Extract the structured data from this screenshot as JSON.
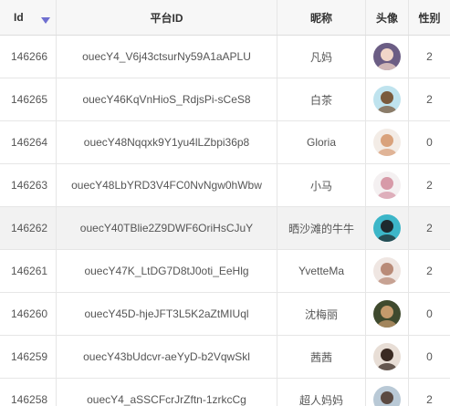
{
  "table": {
    "columns": {
      "id": "Id",
      "platform_id": "平台ID",
      "nickname": "昵称",
      "avatar": "头像",
      "gender": "性别"
    },
    "rows": [
      {
        "id": "146266",
        "platform_id": "ouecY4_V6j43ctsurNy59A1aAPLU",
        "nickname": "凡妈",
        "gender": "2",
        "avatar_icon": "avatar-woman-icon",
        "avatar_bg": "#6b5d84",
        "avatar_fg": "#f1d6c8"
      },
      {
        "id": "146265",
        "platform_id": "ouecY46KqVnHioS_RdjsPi-sCeS8",
        "nickname": "白茶",
        "gender": "2",
        "avatar_icon": "avatar-cartoon-girl-icon",
        "avatar_bg": "#bfe3ee",
        "avatar_fg": "#7a5a3c"
      },
      {
        "id": "146264",
        "platform_id": "ouecY48Nqqxk9Y1yu4lLZbpi36p8",
        "nickname": "Gloria",
        "gender": "0",
        "avatar_icon": "avatar-baby-icon",
        "avatar_bg": "#f3ece6",
        "avatar_fg": "#d9a27c"
      },
      {
        "id": "146263",
        "platform_id": "ouecY48LbYRD3V4FC0NvNgw0hWbw",
        "nickname": "小马",
        "gender": "2",
        "avatar_icon": "avatar-small-figure-icon",
        "avatar_bg": "#f4f0f1",
        "avatar_fg": "#d79aa8"
      },
      {
        "id": "146262",
        "platform_id": "ouecY40TBlie2Z9DWF6OriHsCJuY",
        "nickname": "晒沙滩的牛牛",
        "gender": "2",
        "avatar_icon": "avatar-beach-icon",
        "avatar_bg": "#3cb6c8",
        "avatar_fg": "#1e2a2e"
      },
      {
        "id": "146261",
        "platform_id": "ouecY47K_LtDG7D8tJ0oti_EeHlg",
        "nickname": "YvetteMa",
        "gender": "2",
        "avatar_icon": "avatar-woman-sketch-icon",
        "avatar_bg": "#efe6e2",
        "avatar_fg": "#b98b78"
      },
      {
        "id": "146260",
        "platform_id": "ouecY45D-hjeJFT3L5K2aZtMIUql",
        "nickname": "沈梅丽",
        "gender": "0",
        "avatar_icon": "avatar-outdoor-icon",
        "avatar_bg": "#3f4a2e",
        "avatar_fg": "#c49a6c"
      },
      {
        "id": "146259",
        "platform_id": "ouecY43bUdcvr-aeYyD-b2VqwSkl",
        "nickname": "茜茜",
        "gender": "0",
        "avatar_icon": "avatar-child-icon",
        "avatar_bg": "#e8ded6",
        "avatar_fg": "#3a2a22"
      },
      {
        "id": "146258",
        "platform_id": "ouecY4_aSSCFcrJrZftn-1zrkcCg",
        "nickname": "超人妈妈",
        "gender": "2",
        "avatar_icon": "avatar-mother-icon",
        "avatar_bg": "#b9c9d6",
        "avatar_fg": "#5b4a42"
      }
    ]
  },
  "colors": {
    "header_bg": "#f7f7f7",
    "hover_row_bg": "#f2f2f2",
    "sort_indicator": "#6f6fd0",
    "border": "#e6e6e6"
  }
}
